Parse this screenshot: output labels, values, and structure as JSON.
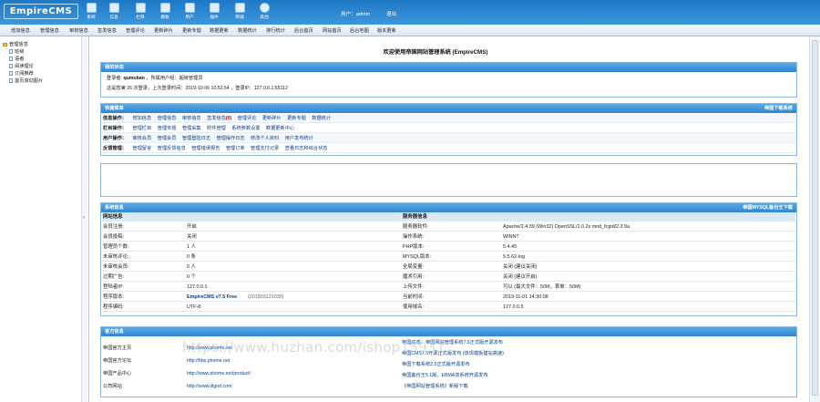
{
  "app": {
    "logo": "EmpireCMS"
  },
  "toolbar": {
    "items": [
      {
        "label": "系统",
        "icon": "gear-icon"
      },
      {
        "label": "信息",
        "icon": "document-icon"
      },
      {
        "label": "栏目",
        "icon": "folder-icon"
      },
      {
        "label": "模板",
        "icon": "template-icon"
      },
      {
        "label": "用户",
        "icon": "user-icon"
      },
      {
        "label": "插件",
        "icon": "puzzle-icon"
      },
      {
        "label": "商城",
        "icon": "shop-icon"
      },
      {
        "label": "其他",
        "icon": "cog-icon"
      }
    ]
  },
  "user": {
    "label": "用户：admin",
    "logout": "退出"
  },
  "menu": [
    "增加信息",
    "管理信息",
    "审核信息",
    "签发信息",
    "管理评论",
    "更新碎片",
    "更新专题",
    "数据更新",
    "数据统计",
    "排行统计",
    "后台首页",
    "网站首页",
    "后台地图",
    "版本更新"
  ],
  "tree": {
    "root": "管理信息",
    "items": [
      "班级",
      "语者",
      "阅读理论",
      "订阅推荐",
      "首页滚动图片"
    ]
  },
  "welcome": "欢迎使用帝国网站管理系统 (EmpireCMS)",
  "my_status": {
    "title": "我的状态",
    "line1_label": "登录者:",
    "line1_user": "qumuban",
    "line1_rest": "，所属用户组：超级管理员",
    "line2": "这是您第 26 次登录，上次登录时间：2019-10-06 10:52:54 ，登录IP：127.0.0.1:55112"
  },
  "quick": {
    "title": "快捷菜单",
    "right": "帝国下载系统",
    "rows": [
      {
        "label": "信息操作：",
        "links": [
          "增加信息",
          "管理信息",
          "审核信息",
          "签发信息",
          "管理评论",
          "更新碎片",
          "更新专题",
          "数据统计"
        ],
        "badge": "(0)"
      },
      {
        "label": "栏目操作：",
        "links": [
          "管理栏目",
          "管理专题",
          "管理采集",
          "附件管理",
          "系统参数设置",
          "数据更新中心"
        ]
      },
      {
        "label": "用户操作：",
        "links": [
          "审核会员",
          "管理会员",
          "管理登陆日志",
          "管理操作日志",
          "修改个人资料",
          "用户发布统计"
        ]
      },
      {
        "label": "反馈管理：",
        "links": [
          "管理留言",
          "管理反馈信息",
          "管理错误报告",
          "管理订单",
          "管理支付记录",
          "查看日志和综合状态"
        ]
      }
    ]
  },
  "sysinfo": {
    "title": "系统信息",
    "right": "帝国MYSQL备份王下载",
    "left_header": "网站信息",
    "right_header": "服务器信息",
    "rows": [
      {
        "k1": "会员注册:",
        "v1": "开启",
        "k2": "服务器软件:",
        "v2": "Apache/2.4.39 (Win32) OpenSSL/1.0.2s mod_fcgid/2.3.9a"
      },
      {
        "k1": "会员投稿:",
        "v1": "关闭",
        "k2": "操作系统:",
        "v2": "WINNT"
      },
      {
        "k1": "管理员个数:",
        "v1": "1 人",
        "k2": "PHP版本:",
        "v2": "5.4.45"
      },
      {
        "k1": "未审核评论:",
        "v1": "0 条",
        "k2": "MYSQL版本:",
        "v2": "5.5.62-log"
      },
      {
        "k1": "未审核会员:",
        "v1": "0 人",
        "k2": "全局变量:",
        "v2": "关闭 (建议关闭)"
      },
      {
        "k1": "过期广告:",
        "v1": "0 个",
        "k2": "魔术引用:",
        "v2": "关闭 (建议开启)"
      },
      {
        "k1": "登陆者IP:",
        "v1": "127.0.0.1",
        "k2": "上传文件:",
        "v2": "可以 (最大文件：50M，表单：50M)"
      },
      {
        "k1": "程序版本:",
        "v1": "EmpireCMS v7.5 Free",
        "v1b": "(201803121030)",
        "k2": "当前时间:",
        "v2": "2019-11-01 14:30:08"
      },
      {
        "k1": "程序编码:",
        "v1": "UTF-8",
        "k2": "使用域名:",
        "v2": "127.0.0.5"
      }
    ]
  },
  "official": {
    "title": "官方信息",
    "links": [
      {
        "k": "帝国官方主页",
        "v": "http://www.phome.net"
      },
      {
        "k": "帝国官方论坛",
        "v": "http://bbs.phome.net"
      },
      {
        "k": "帝国产品中心",
        "v": "http://www.phome.net/product/"
      },
      {
        "k": "公司网站",
        "v": "http://www.digod.com"
      }
    ],
    "news": [
      "帝国动态：帝国网站管理系统7.5正式版开源发布",
      "帝国CMS7.5开源正式版发布 (体现模板建站高速)",
      "帝国下载系统2.5正式版开源发布",
      "帝国备份王5.1版，EBMA双系统开源发布",
      "《帝国网站管理系统》新版下载"
    ]
  },
  "watermark": "https://www.huzhan.com/ishop15931"
}
